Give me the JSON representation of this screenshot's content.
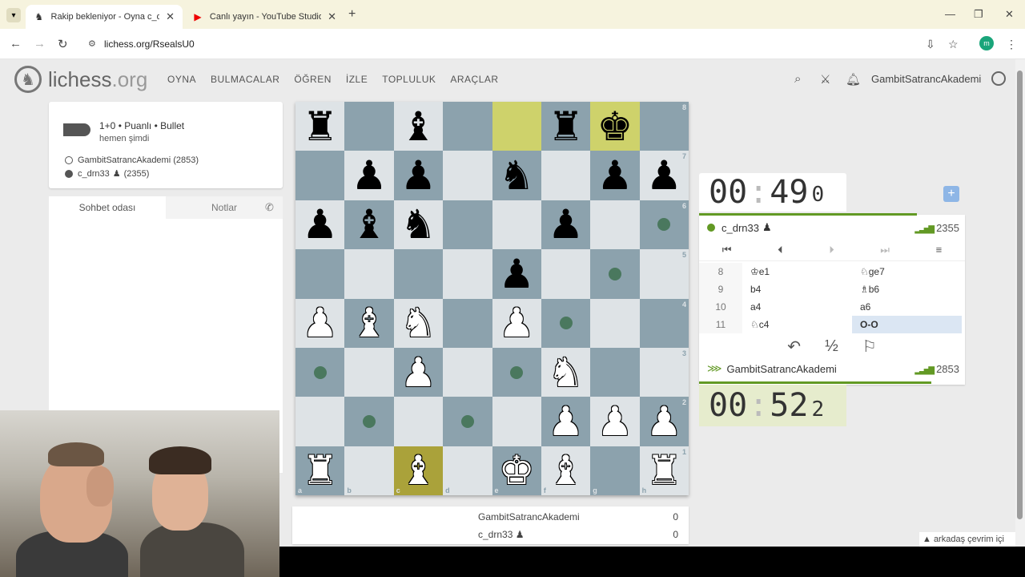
{
  "browser": {
    "tabs": [
      {
        "title": "Rakip bekleniyor - Oyna c_drn3",
        "active": true
      },
      {
        "title": "Canlı yayın - YouTube Studio",
        "active": false
      }
    ],
    "url": "lichess.org/RsealsU0",
    "profile_initial": "m"
  },
  "site": {
    "logo_main": "lichess",
    "logo_tld": ".org",
    "nav": [
      "OYNA",
      "BULMACALAR",
      "ÖĞREN",
      "İZLE",
      "TOPLULUK",
      "ARAÇLAR"
    ],
    "username": "GambitSatrancAkademi"
  },
  "game_info": {
    "type": "1+0 • Puanlı • Bullet",
    "time": "hemen şimdi",
    "white_player": "GambitSatrancAkademi (2853)",
    "black_player": "c_drn33",
    "black_rating": "(2355)"
  },
  "chat": {
    "tab_chat": "Sohbet odası",
    "tab_notes": "Notlar"
  },
  "board": {
    "ranks": [
      "8",
      "7",
      "6",
      "5",
      "4",
      "3",
      "2",
      "1"
    ],
    "files": [
      "a",
      "b",
      "c",
      "d",
      "e",
      "f",
      "g",
      "h"
    ],
    "rows": [
      [
        "bR",
        "",
        "bB",
        "",
        "",
        "bR",
        "bK",
        ""
      ],
      [
        "",
        "bP",
        "bP",
        "",
        "bN",
        "",
        "bP",
        "bP"
      ],
      [
        "bP",
        "bB",
        "bN",
        "",
        "",
        "bP",
        "",
        ""
      ],
      [
        "",
        "",
        "",
        "",
        "bP",
        "",
        "",
        ""
      ],
      [
        "wP",
        "wB",
        "wN",
        "",
        "wP",
        "",
        "",
        ""
      ],
      [
        "",
        "",
        "wP",
        "",
        "",
        "wN",
        "",
        ""
      ],
      [
        "",
        "",
        "",
        "",
        "",
        "wP",
        "wP",
        "wP"
      ],
      [
        "wR",
        "",
        "wB",
        "",
        "wK",
        "wB",
        "",
        "wR"
      ]
    ],
    "highlights": [
      "e8",
      "g8",
      "c1"
    ],
    "move_dots": [
      "h6",
      "g5",
      "f4",
      "a3",
      "e3",
      "b2",
      "d2"
    ]
  },
  "score": {
    "white_name": "GambitSatrancAkademi",
    "white_score": "0",
    "black_name": "c_drn33",
    "black_score": "0"
  },
  "clocks": {
    "top": {
      "min": "00",
      "sec": "49",
      "frac": "0"
    },
    "bottom": {
      "min": "00",
      "sec": "52",
      "frac": "2"
    }
  },
  "players": {
    "top_name": "c_drn33",
    "top_rating": "2355",
    "bottom_name": "GambitSatrancAkademi",
    "bottom_rating": "2853"
  },
  "moves": [
    {
      "num": "8",
      "white": "♔e1",
      "black": "♘ge7"
    },
    {
      "num": "9",
      "white": "b4",
      "black": "♗b6"
    },
    {
      "num": "10",
      "white": "a4",
      "black": "a6"
    },
    {
      "num": "11",
      "white": "♘c4",
      "black": "O-O"
    }
  ],
  "actions": {
    "draw_label": "½"
  },
  "friends_online": "▲ arkadaş çevrim içi"
}
